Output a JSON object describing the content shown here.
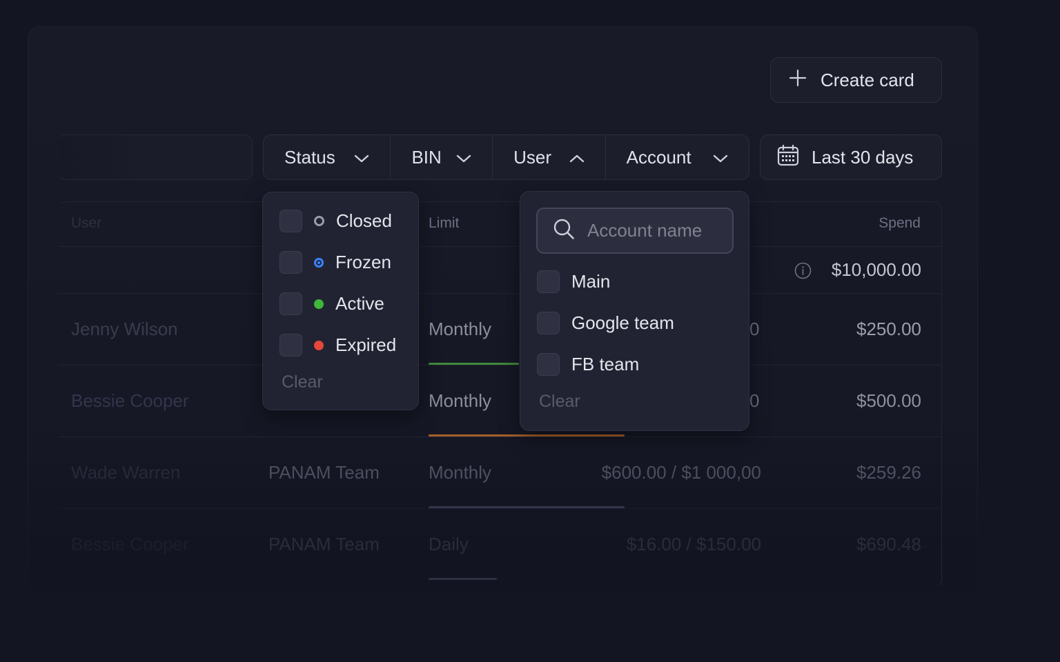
{
  "toolbar": {
    "create_label": "Create card",
    "date_label": "Last 30 days"
  },
  "filters": {
    "status": "Status",
    "bin": "BIN",
    "user": "User",
    "account": "Account"
  },
  "table": {
    "headers": {
      "user": "User",
      "limit": "Limit",
      "spend": "Spend"
    },
    "total_spend": "$10,000.00",
    "rows": [
      {
        "user": "Jenny Wilson",
        "account": "",
        "period": "Monthly",
        "limit": "0",
        "spend": "$250.00",
        "bar_color": "#3f8a3a",
        "bar_fraction": 0.46
      },
      {
        "user": "Bessie Cooper",
        "account": "",
        "period": "Monthly",
        "limit": "0",
        "spend": "$500.00",
        "bar_color": "#a8602a",
        "bar_fraction": 1.0
      },
      {
        "user": "Wade Warren",
        "account": "PANAM Team",
        "period": "Monthly",
        "limit": "$600.00 / $1 000,00",
        "spend": "$259.26",
        "bar_color": "#33364a",
        "bar_fraction": 1.0
      },
      {
        "user": "Bessie Cooper",
        "account": "PANAM Team",
        "period": "Daily",
        "limit": "$16.00 / $150.00",
        "spend": "$690.48",
        "bar_color": "#2e3042",
        "bar_fraction": 0.35
      }
    ]
  },
  "status_dropdown": {
    "options": [
      {
        "label": "Closed",
        "color": "#9a9cab"
      },
      {
        "label": "Frozen",
        "color": "#3b82f6"
      },
      {
        "label": "Active",
        "color": "#3fb53a"
      },
      {
        "label": "Expired",
        "color": "#e5473b"
      }
    ],
    "clear_label": "Clear"
  },
  "account_dropdown": {
    "search_placeholder": "Account name",
    "options": [
      "Main",
      "Google team",
      "FB team"
    ],
    "clear_label": "Clear"
  }
}
